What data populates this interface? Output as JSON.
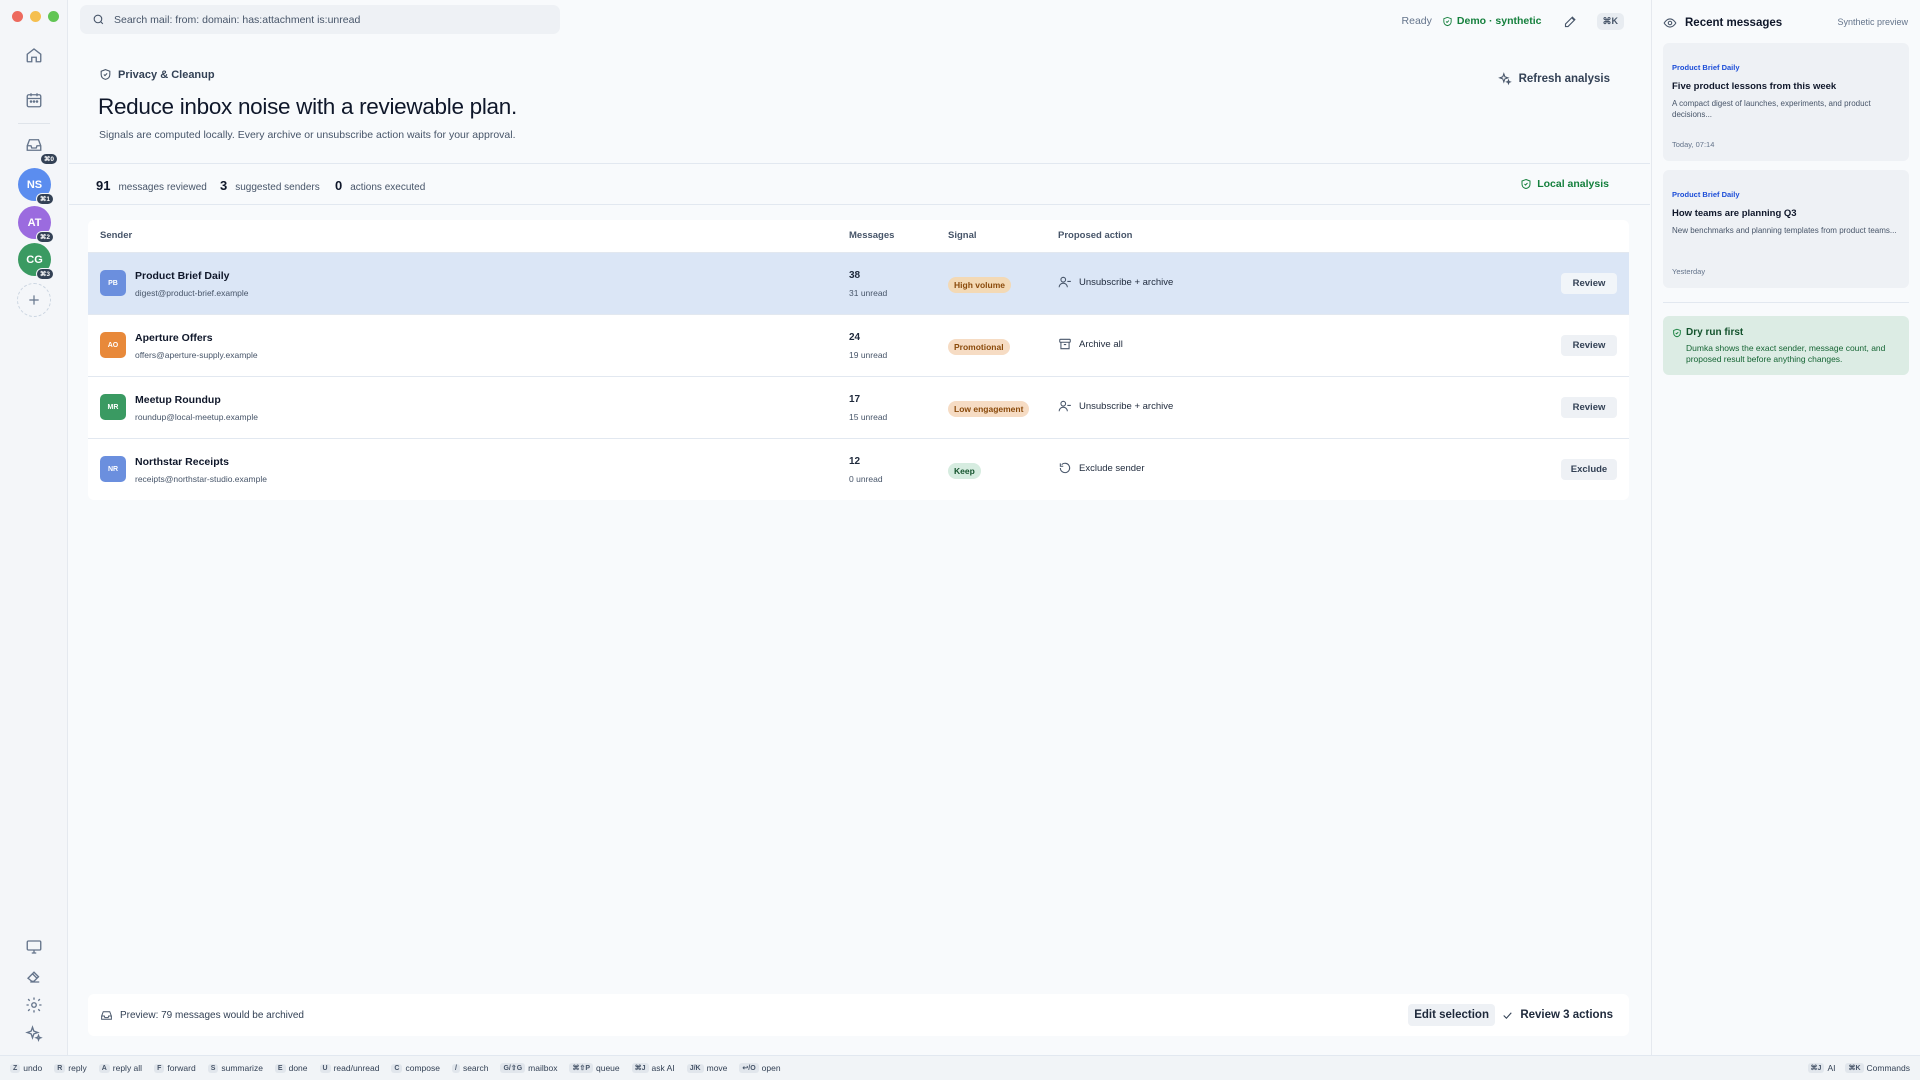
{
  "window": {
    "traffic": [
      "#ed6a5e",
      "#f5bf4f",
      "#61c554"
    ]
  },
  "rail": {
    "nav_icons": [
      "home-icon",
      "calendar-icon",
      "inbox-icon"
    ],
    "inbox_badge": "⌘0",
    "accounts": [
      {
        "initials": "NS",
        "badge": "⌘1",
        "color": "#5b8def"
      },
      {
        "initials": "AT",
        "badge": "⌘2",
        "color": "#9b6bdf"
      },
      {
        "initials": "CG",
        "badge": "⌘3",
        "color": "#3a9a62"
      }
    ],
    "bottom_icons": [
      "monitor-icon",
      "eraser-icon",
      "gear-icon",
      "sparkle-icon"
    ]
  },
  "topbar": {
    "search_placeholder": "Search mail: from: domain: has:attachment is:unread",
    "status": "Ready",
    "mode": "Demo · synthetic",
    "shortcut": "⌘K"
  },
  "header": {
    "eyebrow": "Privacy & Cleanup",
    "title": "Reduce inbox noise with a reviewable plan.",
    "subtitle": "Signals are computed locally. Every archive or unsubscribe action waits for your approval.",
    "refresh_label": "Refresh analysis"
  },
  "stats": {
    "reviewed_num": "91",
    "reviewed_label": "messages reviewed",
    "senders_num": "3",
    "senders_label": "suggested senders",
    "actions_num": "0",
    "actions_label": "actions executed",
    "local_label": "Local analysis"
  },
  "table": {
    "headers": {
      "sender": "Sender",
      "messages": "Messages",
      "signal": "Signal",
      "action": "Proposed action"
    },
    "rows": [
      {
        "initials": "PB",
        "avatar_color": "#6b8fde",
        "name": "Product Brief Daily",
        "email": "digest@product-brief.example",
        "count": "38",
        "unread": "31 unread",
        "signal": "High volume",
        "signal_bg": "#f3d9b5",
        "signal_fg": "#8a4a0b",
        "action": "Unsubscribe + archive",
        "action_icon": "user-minus-icon",
        "button": "Review",
        "selected": true
      },
      {
        "initials": "AO",
        "avatar_color": "#e8893a",
        "name": "Aperture Offers",
        "email": "offers@aperture-supply.example",
        "count": "24",
        "unread": "19 unread",
        "signal": "Promotional",
        "signal_bg": "#f6dcc4",
        "signal_fg": "#8a4a0b",
        "action": "Archive all",
        "action_icon": "archive-icon",
        "button": "Review",
        "selected": false
      },
      {
        "initials": "MR",
        "avatar_color": "#3a9a62",
        "name": "Meetup Roundup",
        "email": "roundup@local-meetup.example",
        "count": "17",
        "unread": "15 unread",
        "signal": "Low engagement",
        "signal_bg": "#f6dcc4",
        "signal_fg": "#8a4a0b",
        "action": "Unsubscribe + archive",
        "action_icon": "user-minus-icon",
        "button": "Review",
        "selected": false
      },
      {
        "initials": "NR",
        "avatar_color": "#6b8fde",
        "name": "Northstar Receipts",
        "email": "receipts@northstar-studio.example",
        "count": "12",
        "unread": "0 unread",
        "signal": "Keep",
        "signal_bg": "#d6ece0",
        "signal_fg": "#14532d",
        "action": "Exclude sender",
        "action_icon": "undo-icon",
        "button": "Exclude",
        "selected": false
      }
    ]
  },
  "footer": {
    "preview": "Preview: 79 messages would be archived",
    "edit_label": "Edit selection",
    "review_label": "Review 3 actions"
  },
  "right_panel": {
    "title": "Recent messages",
    "tag": "Synthetic preview",
    "cards": [
      {
        "from": "Product Brief Daily",
        "subject": "Five product lessons from this week",
        "snippet": "A compact digest of launches, experiments, and product decisions...",
        "time": "Today, 07:14"
      },
      {
        "from": "Product Brief Daily",
        "subject": "How teams are planning Q3",
        "snippet": "New benchmarks and planning templates from product teams...",
        "time": "Yesterday"
      }
    ],
    "dry_run": {
      "title": "Dry run first",
      "text": "Dumka shows the exact sender, message count, and proposed result before anything changes."
    }
  },
  "shortcuts": {
    "left": [
      {
        "key": "Z",
        "label": "undo"
      },
      {
        "key": "R",
        "label": "reply"
      },
      {
        "key": "A",
        "label": "reply all"
      },
      {
        "key": "F",
        "label": "forward"
      },
      {
        "key": "S",
        "label": "summarize"
      },
      {
        "key": "E",
        "label": "done"
      },
      {
        "key": "U",
        "label": "read/unread"
      },
      {
        "key": "C",
        "label": "compose"
      },
      {
        "key": "/",
        "label": "search"
      },
      {
        "key": "G/⇧G",
        "label": "mailbox"
      },
      {
        "key": "⌘⇧P",
        "label": "queue"
      },
      {
        "key": "⌘J",
        "label": "ask AI"
      },
      {
        "key": "J/K",
        "label": "move"
      },
      {
        "key": "↩/O",
        "label": "open"
      }
    ],
    "right": [
      {
        "key": "⌘J",
        "label": "AI"
      },
      {
        "key": "⌘K",
        "label": "Commands"
      }
    ]
  }
}
